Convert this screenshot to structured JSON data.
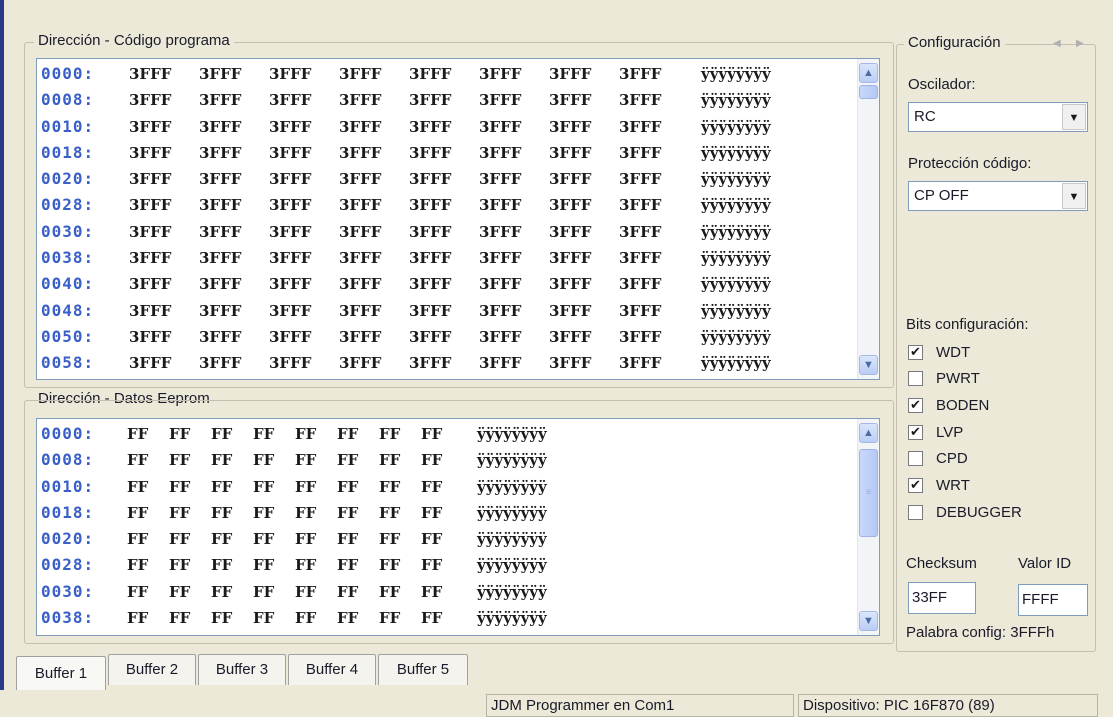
{
  "program_group": {
    "title": "Dirección - Código programa",
    "addresses": [
      "0000:",
      "0008:",
      "0010:",
      "0018:",
      "0020:",
      "0028:",
      "0030:",
      "0038:",
      "0040:",
      "0048:",
      "0050:",
      "0058:"
    ],
    "word": "3FFF",
    "ascii": "ÿÿÿÿÿÿÿÿ"
  },
  "eeprom_group": {
    "title": "Dirección - Datos Eeprom",
    "addresses": [
      "0000:",
      "0008:",
      "0010:",
      "0018:",
      "0020:",
      "0028:",
      "0030:",
      "0038:"
    ],
    "byte": "FF",
    "ascii": "ÿÿÿÿÿÿÿÿ"
  },
  "config": {
    "title": "Configuración",
    "oscillator_label": "Oscilador:",
    "oscillator_value": "RC",
    "protection_label": "Protección código:",
    "protection_value": "CP OFF",
    "bits_label": "Bits configuración:",
    "bits": [
      {
        "label": "WDT",
        "checked": true
      },
      {
        "label": "PWRT",
        "checked": false
      },
      {
        "label": "BODEN",
        "checked": true
      },
      {
        "label": "LVP",
        "checked": true
      },
      {
        "label": "CPD",
        "checked": false
      },
      {
        "label": "WRT",
        "checked": true
      },
      {
        "label": "DEBUGGER",
        "checked": false
      }
    ],
    "checksum_label": "Checksum",
    "checksum_value": "33FF",
    "id_label": "Valor ID",
    "id_value": "FFFF",
    "config_word": "Palabra config: 3FFFh"
  },
  "tabs": [
    "Buffer 1",
    "Buffer 2",
    "Buffer 3",
    "Buffer 4",
    "Buffer 5"
  ],
  "active_tab": 0,
  "status": {
    "programmer": "JDM Programmer en Com1",
    "device": "Dispositivo: PIC 16F870  (89)"
  },
  "icons": {
    "scroll_up": "chevron-up-icon",
    "scroll_down": "chevron-down-icon",
    "dropdown": "dropdown-arrow-icon",
    "check": "checkmark-icon",
    "nav_left": "triangle-left-icon",
    "nav_right": "triangle-right-icon"
  }
}
